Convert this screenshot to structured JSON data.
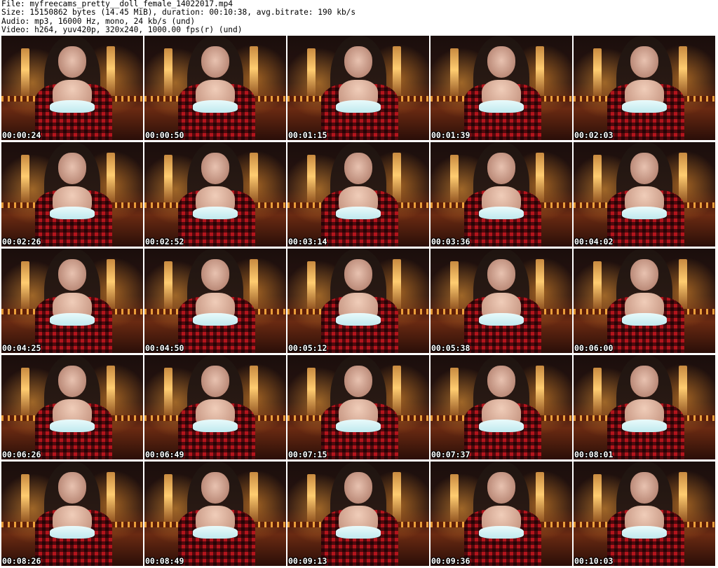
{
  "header": {
    "lines": [
      "File: myfreecams_pretty__doll_female_14022017.mp4",
      "Size: 15150862 bytes (14.45 MiB), duration: 00:10:38, avg.bitrate: 190 kb/s",
      "Audio: mp3, 16000 Hz, mono, 24 kb/s (und)",
      "Video: h264, yuv420p, 320x240, 1000.00 fps(r) (und)"
    ]
  },
  "thumbnails": [
    {
      "timestamp": "00:00:24"
    },
    {
      "timestamp": "00:00:50"
    },
    {
      "timestamp": "00:01:15"
    },
    {
      "timestamp": "00:01:39"
    },
    {
      "timestamp": "00:02:03"
    },
    {
      "timestamp": "00:02:26"
    },
    {
      "timestamp": "00:02:52"
    },
    {
      "timestamp": "00:03:14"
    },
    {
      "timestamp": "00:03:36"
    },
    {
      "timestamp": "00:04:02"
    },
    {
      "timestamp": "00:04:25"
    },
    {
      "timestamp": "00:04:50"
    },
    {
      "timestamp": "00:05:12"
    },
    {
      "timestamp": "00:05:38"
    },
    {
      "timestamp": "00:06:00"
    },
    {
      "timestamp": "00:06:26"
    },
    {
      "timestamp": "00:06:49"
    },
    {
      "timestamp": "00:07:15"
    },
    {
      "timestamp": "00:07:37"
    },
    {
      "timestamp": "00:08:01"
    },
    {
      "timestamp": "00:08:26"
    },
    {
      "timestamp": "00:08:49"
    },
    {
      "timestamp": "00:09:13"
    },
    {
      "timestamp": "00:09:36"
    },
    {
      "timestamp": "00:10:03"
    }
  ]
}
